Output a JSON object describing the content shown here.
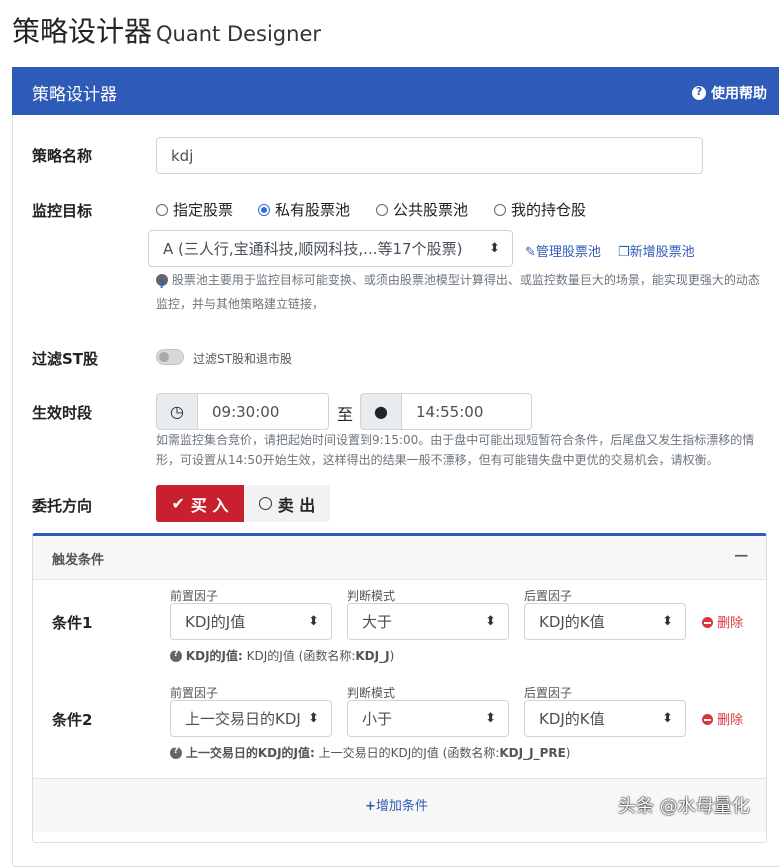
{
  "page": {
    "title": "策略设计器",
    "subtitle": "Quant Designer"
  },
  "card": {
    "title": "策略设计器",
    "help": "使用帮助"
  },
  "form": {
    "name_label": "策略名称",
    "name_value": "kdj",
    "target_label": "监控目标",
    "target_options": [
      "指定股票",
      "私有股票池",
      "公共股票池",
      "我的持仓股"
    ],
    "target_selected": 1,
    "pool_value": "A (三人行,宝通科技,顺网科技,...等17个股票)",
    "manage_pool": "管理股票池",
    "new_pool": "新增股票池",
    "pool_help": "股票池主要用于监控目标可能变换、或须由股票池模型计算得出、或监控数量巨大的场景，能实现更强大的动态监控，并与其他策略建立链接，",
    "st_label": "过滤ST股",
    "st_toggle": "过滤ST股和退市股",
    "st_on": false,
    "time_label": "生效时段",
    "start": "09:30:00",
    "to": "至",
    "end": "14:55:00",
    "time_help": "如需监控集合竞价，请把起始时间设置到9:15:00。由于盘中可能出现短暂符合条件，后尾盘又发生指标漂移的情形，可设置从14:50开始生效，这样得出的结果一般不漂移，但有可能错失盘中更优的交易机会，请权衡。",
    "dir_label": "委托方向",
    "buy": "买 入",
    "sell": "卖 出",
    "dir_selected": "buy"
  },
  "trigger": {
    "title": "触发条件",
    "collapse": "−",
    "col_labels": [
      "前置因子",
      "判断模式",
      "后置因子"
    ],
    "delete": "删除",
    "conditions": [
      {
        "label": "条件1",
        "pre": "KDJ的J值",
        "mode": "大于",
        "post": "KDJ的K值",
        "hint_name": "KDJ的J值:",
        "hint_desc": " KDJ的J值 (函数名称:",
        "hint_fn": "KDJ_J",
        ")": ")"
      },
      {
        "label": "条件2",
        "pre": "上一交易日的KDJ",
        "mode": "小于",
        "post": "KDJ的K值",
        "hint_name": "上一交易日的KDJ的J值:",
        "hint_desc": " 上一交易日的KDJ的J值 (函数名称:",
        "hint_fn": "KDJ_J_PRE",
        ")": ")"
      }
    ],
    "add": "增加条件"
  },
  "watermark": "头条 @水母量化"
}
